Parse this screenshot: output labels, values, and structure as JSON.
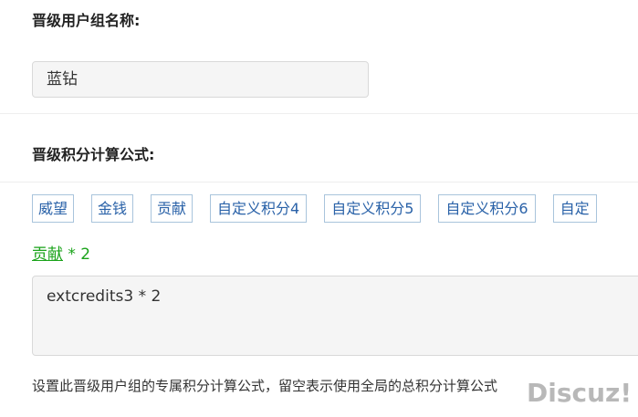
{
  "form": {
    "group_name_label": "晋级用户组名称:",
    "group_name_value": "蓝钻",
    "formula_label": "晋级积分计算公式:",
    "credit_chips": [
      "威望",
      "金钱",
      "贡献",
      "自定义积分4",
      "自定义积分5",
      "自定义积分6",
      "自定"
    ],
    "formula_preview": {
      "link_text": "贡献",
      "rest_text": " * 2"
    },
    "formula_value": "extcredits3 * 2",
    "help_text": "设置此晋级用户组的专属积分计算公式，留空表示使用全局的总积分计算公式"
  },
  "watermark": "Discuz!",
  "colors": {
    "chip_text": "#2a62a8",
    "chip_border": "#a9c4dc",
    "preview_green": "#1aa31a",
    "input_bg": "#f5f5f5"
  }
}
